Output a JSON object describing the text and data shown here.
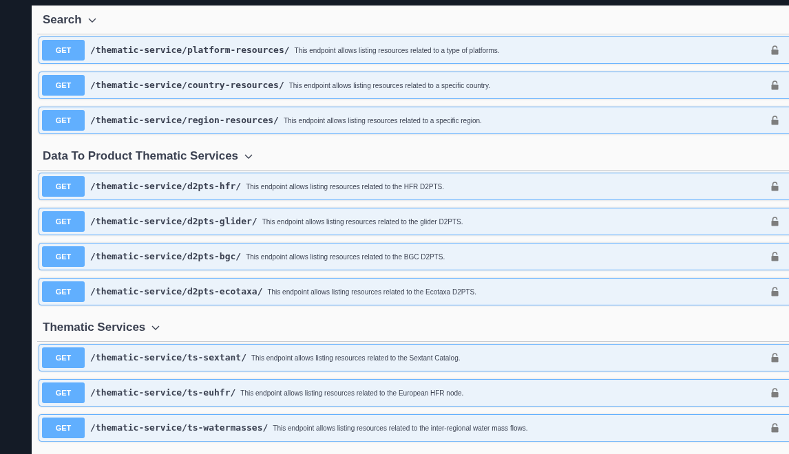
{
  "sections": [
    {
      "title": "Search",
      "expanded": true,
      "operations": [
        {
          "method": "GET",
          "path": "/thematic-service/platform-resources/",
          "description": "This endpoint allows listing resources related to a type of platforms.",
          "locked": false
        },
        {
          "method": "GET",
          "path": "/thematic-service/country-resources/",
          "description": "This endpoint allows listing resources related to a specific country.",
          "locked": false
        },
        {
          "method": "GET",
          "path": "/thematic-service/region-resources/",
          "description": "This endpoint allows listing resources related to a specific region.",
          "locked": false
        }
      ]
    },
    {
      "title": "Data To Product Thematic Services",
      "expanded": true,
      "operations": [
        {
          "method": "GET",
          "path": "/thematic-service/d2pts-hfr/",
          "description": "This endpoint allows listing resources related to the HFR D2PTS.",
          "locked": false
        },
        {
          "method": "GET",
          "path": "/thematic-service/d2pts-glider/",
          "description": "This endpoint allows listing resources related to the glider D2PTS.",
          "locked": false
        },
        {
          "method": "GET",
          "path": "/thematic-service/d2pts-bgc/",
          "description": "This endpoint allows listing resources related to the BGC D2PTS.",
          "locked": false
        },
        {
          "method": "GET",
          "path": "/thematic-service/d2pts-ecotaxa/",
          "description": "This endpoint allows listing resources related to the Ecotaxa D2PTS.",
          "locked": false
        }
      ]
    },
    {
      "title": "Thematic Services",
      "expanded": true,
      "operations": [
        {
          "method": "GET",
          "path": "/thematic-service/ts-sextant/",
          "description": "This endpoint allows listing resources related to the Sextant Catalog.",
          "locked": false
        },
        {
          "method": "GET",
          "path": "/thematic-service/ts-euhfr/",
          "description": "This endpoint allows listing resources related to the European HFR node.",
          "locked": false
        },
        {
          "method": "GET",
          "path": "/thematic-service/ts-watermasses/",
          "description": "This endpoint allows listing resources related to the inter-regional water mass flows.",
          "locked": false
        }
      ]
    }
  ]
}
